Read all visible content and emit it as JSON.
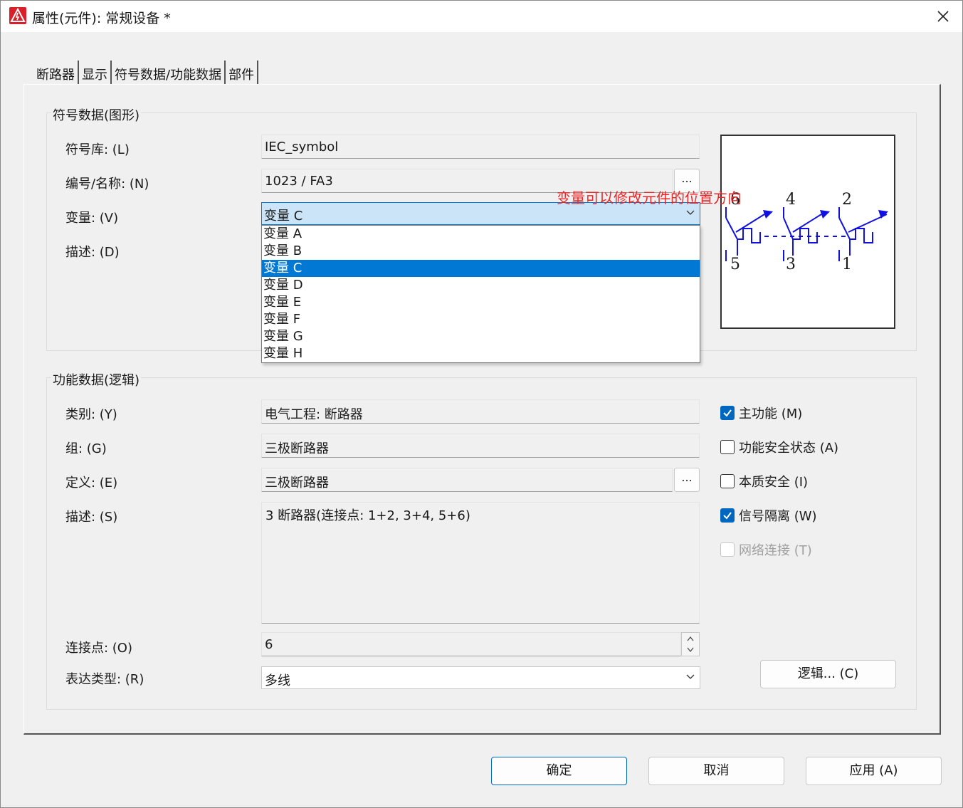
{
  "window": {
    "title": "属性(元件): 常规设备 *"
  },
  "tabs": [
    {
      "label": "断路器"
    },
    {
      "label": "显示"
    },
    {
      "label": "符号数据/功能数据"
    },
    {
      "label": "部件"
    }
  ],
  "symbol_group": {
    "title": "符号数据(图形)",
    "library_label": "符号库: (L)",
    "library_value": "IEC_symbol",
    "number_label": "编号/名称: (N)",
    "number_value": "1023 / FA3",
    "variant_label": "变量: (V)",
    "variant_value": "变量 C",
    "description_label": "描述: (D)",
    "browse_label": "..."
  },
  "variant_options": [
    "变量 A",
    "变量 B",
    "变量 C",
    "变量 D",
    "变量 E",
    "变量 F",
    "变量 G",
    "变量 H"
  ],
  "annotation": "变量可以修改元件的位置方向",
  "preview": {
    "terminals_top": [
      "6",
      "4",
      "2"
    ],
    "terminals_bottom": [
      "5",
      "3",
      "1"
    ]
  },
  "function_group": {
    "title": "功能数据(逻辑)",
    "category_label": "类别: (Y)",
    "category_value": "电气工程: 断路器",
    "group_label": "组: (G)",
    "group_value": "三极断路器",
    "definition_label": "定义: (E)",
    "definition_value": "三极断路器",
    "description_label": "描述: (S)",
    "description_value": "3 断路器(连接点: 1+2, 3+4, 5+6)",
    "connections_label": "连接点: (O)",
    "connections_value": "6",
    "representation_label": "表达类型: (R)",
    "representation_value": "多线",
    "browse_label": "...",
    "logic_button": "逻辑... (C)"
  },
  "checkboxes": {
    "main_function": {
      "label": "主功能 (M)",
      "checked": true
    },
    "safety_state": {
      "label": "功能安全状态 (A)",
      "checked": false
    },
    "intrinsic_safety": {
      "label": "本质安全 (I)",
      "checked": false
    },
    "signal_isolation": {
      "label": "信号隔离 (W)",
      "checked": true
    },
    "network_connection": {
      "label": "网络连接 (T)",
      "checked": false,
      "disabled": true
    }
  },
  "footer": {
    "ok": "确定",
    "cancel": "取消",
    "apply": "应用 (A)"
  },
  "colors": {
    "accent": "#0078d4",
    "annotation": "#e8282a",
    "symbol": "#1010e0"
  }
}
